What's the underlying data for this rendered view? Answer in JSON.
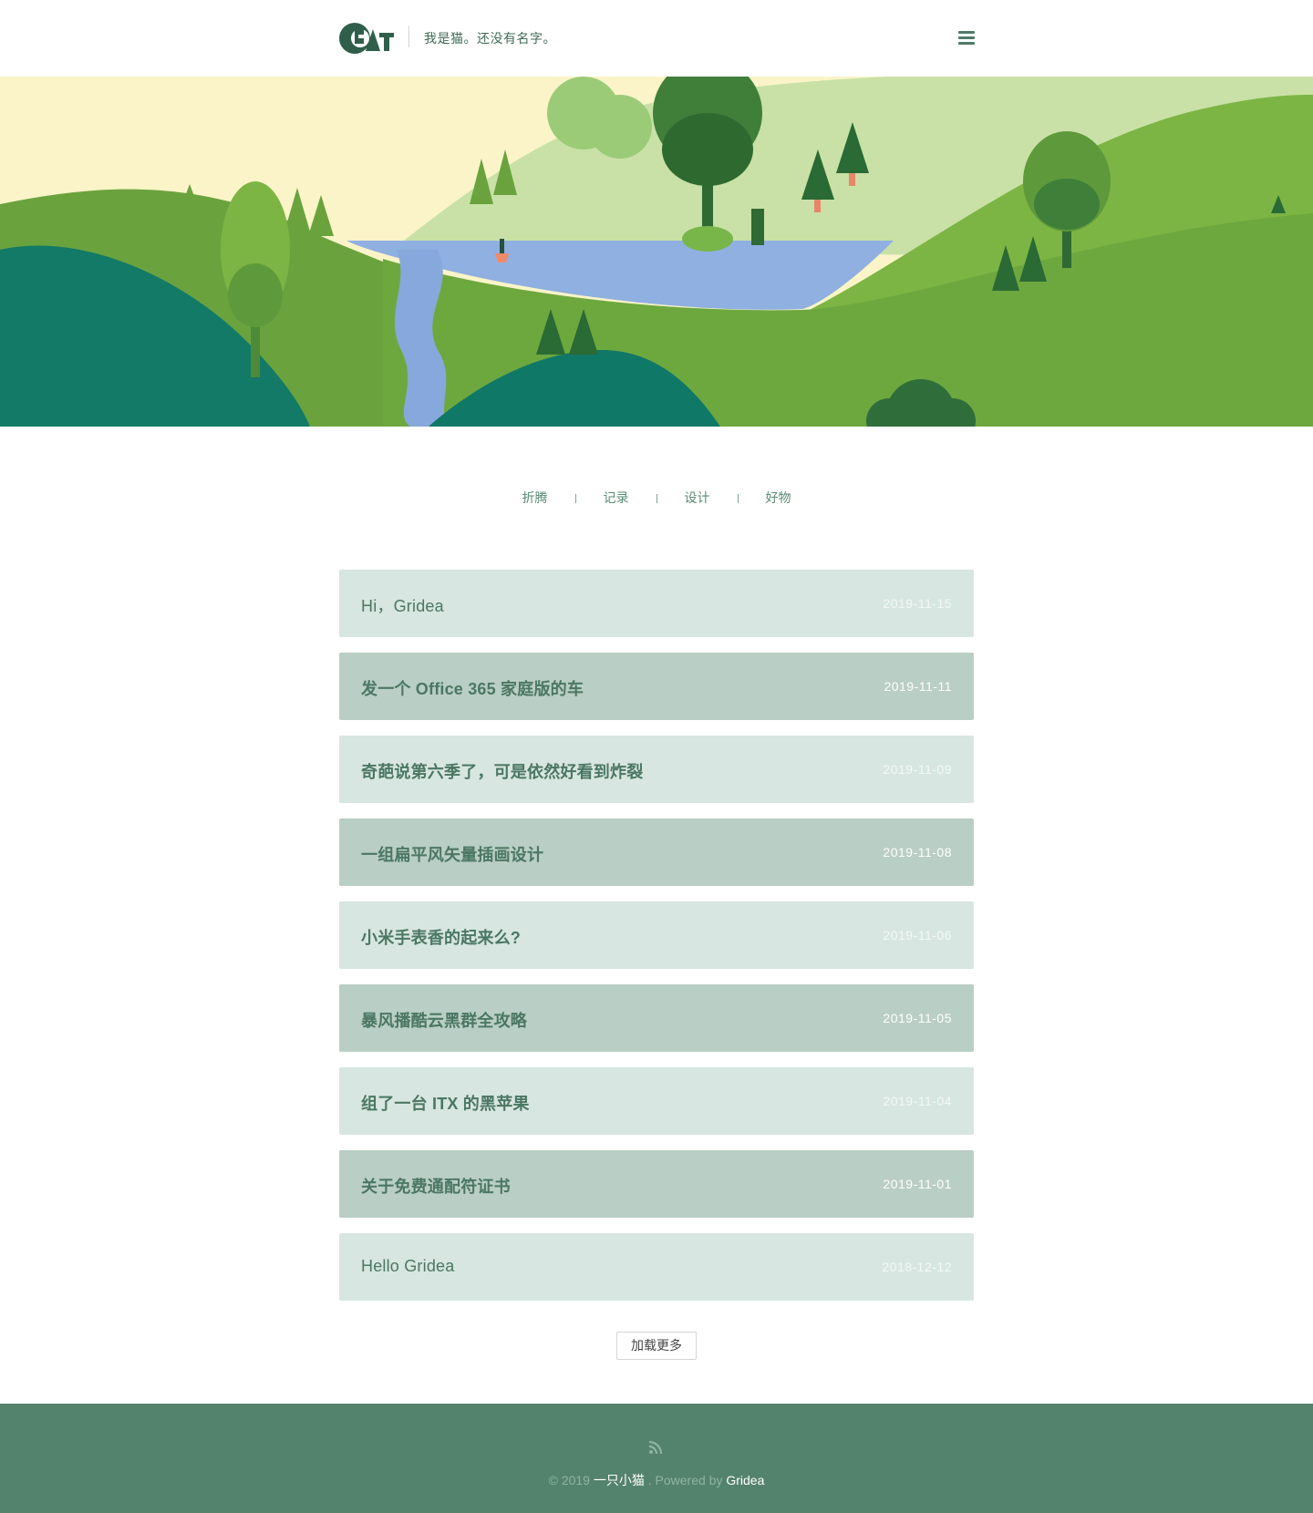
{
  "header": {
    "logo_text": "CAT",
    "tagline": "我是猫。还没有名字。",
    "menu_icon": "hamburger-menu-icon"
  },
  "nav": {
    "items": [
      {
        "label": "折腾"
      },
      {
        "label": "记录"
      },
      {
        "label": "设计"
      },
      {
        "label": "好物"
      }
    ]
  },
  "posts": [
    {
      "title": "Hi，Gridea",
      "date": "2019-11-15"
    },
    {
      "title": "发一个 Office 365 家庭版的车",
      "date": "2019-11-11"
    },
    {
      "title": "奇葩说第六季了，可是依然好看到炸裂",
      "date": "2019-11-09"
    },
    {
      "title": "一组扁平风矢量插画设计",
      "date": "2019-11-08"
    },
    {
      "title": "小米手表香的起来么?",
      "date": "2019-11-06"
    },
    {
      "title": "暴风播酷云黑群全攻略",
      "date": "2019-11-05"
    },
    {
      "title": "组了一台 ITX 的黑苹果",
      "date": "2019-11-04"
    },
    {
      "title": "关于免费通配符证书",
      "date": "2019-11-01"
    },
    {
      "title": "Hello Gridea",
      "date": "2018-12-12"
    }
  ],
  "load_more_label": "加载更多",
  "footer": {
    "rss_icon": "rss-icon",
    "copyright_prefix": "© 2019",
    "author": "一只小猫",
    "powered_by": ". Powered by",
    "engine": "Gridea"
  },
  "colors": {
    "accent": "#54836d",
    "post_light": "#d7e6e0",
    "post_dark": "#b9cec4",
    "sky": "#fbf5c6",
    "water": "#8fb0e0"
  }
}
